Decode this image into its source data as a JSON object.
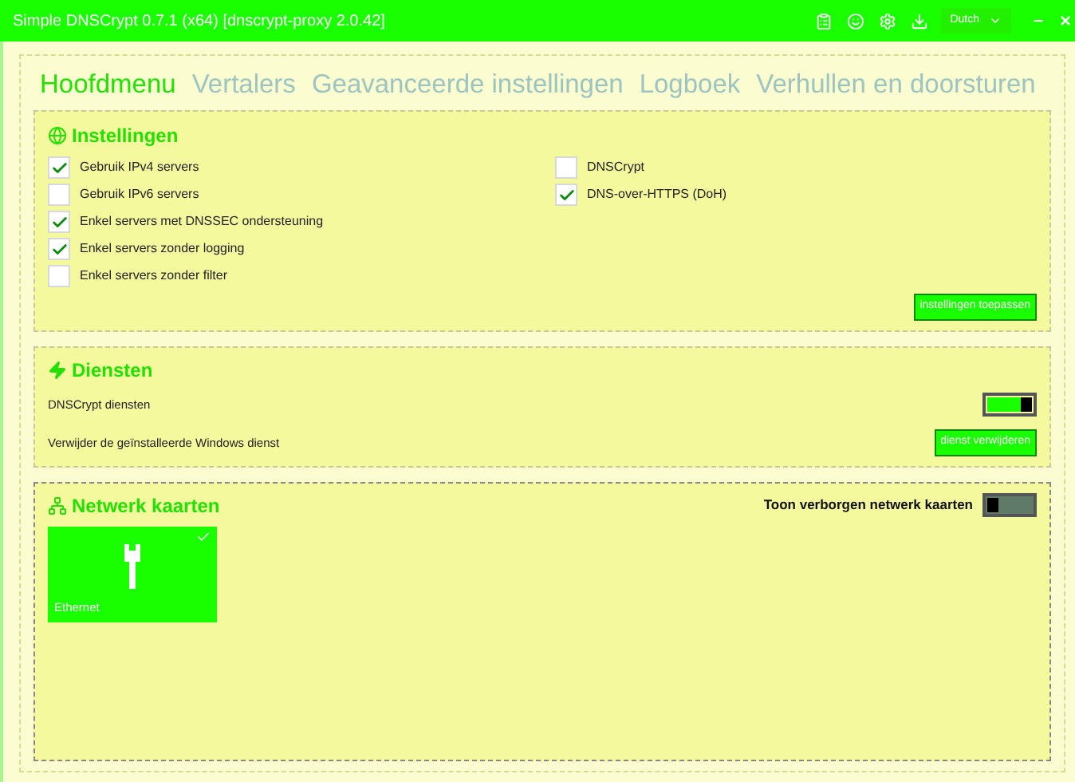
{
  "window": {
    "title": "Simple DNSCrypt 0.7.1 (x64) [dnscrypt-proxy 2.0.42]",
    "language": "Dutch",
    "minimize": "–",
    "close": "×"
  },
  "tabs": [
    {
      "label": "Hoofdmenu",
      "selected": true
    },
    {
      "label": "Vertalers",
      "selected": false
    },
    {
      "label": "Geavanceerde instellingen",
      "selected": false
    },
    {
      "label": "Logboek",
      "selected": false
    },
    {
      "label": "Verhullen en doorsturen",
      "selected": false
    }
  ],
  "settings": {
    "title": "Instellingen",
    "left": [
      {
        "label": "Gebruik IPv4 servers",
        "checked": true
      },
      {
        "label": "Gebruik IPv6 servers",
        "checked": false
      },
      {
        "label": "Enkel servers met DNSSEC ondersteuning",
        "checked": true
      },
      {
        "label": "Enkel servers zonder logging",
        "checked": true
      },
      {
        "label": "Enkel servers zonder filter",
        "checked": false
      }
    ],
    "right": [
      {
        "label": "DNSCrypt",
        "checked": false
      },
      {
        "label": "DNS-over-HTTPS (DoH)",
        "checked": true
      }
    ],
    "apply_button": "instellingen toepassen"
  },
  "services": {
    "title": "Diensten",
    "service_label": "DNSCrypt diensten",
    "service_on": true,
    "remove_label": "Verwijder de geïnstalleerde Windows dienst",
    "remove_button": "dienst verwijderen"
  },
  "network": {
    "title": "Netwerk kaarten",
    "hidden_label": "Toon verborgen netwerk kaarten",
    "hidden_on": false,
    "cards": [
      {
        "name": "Ethernet",
        "selected": true
      }
    ]
  }
}
